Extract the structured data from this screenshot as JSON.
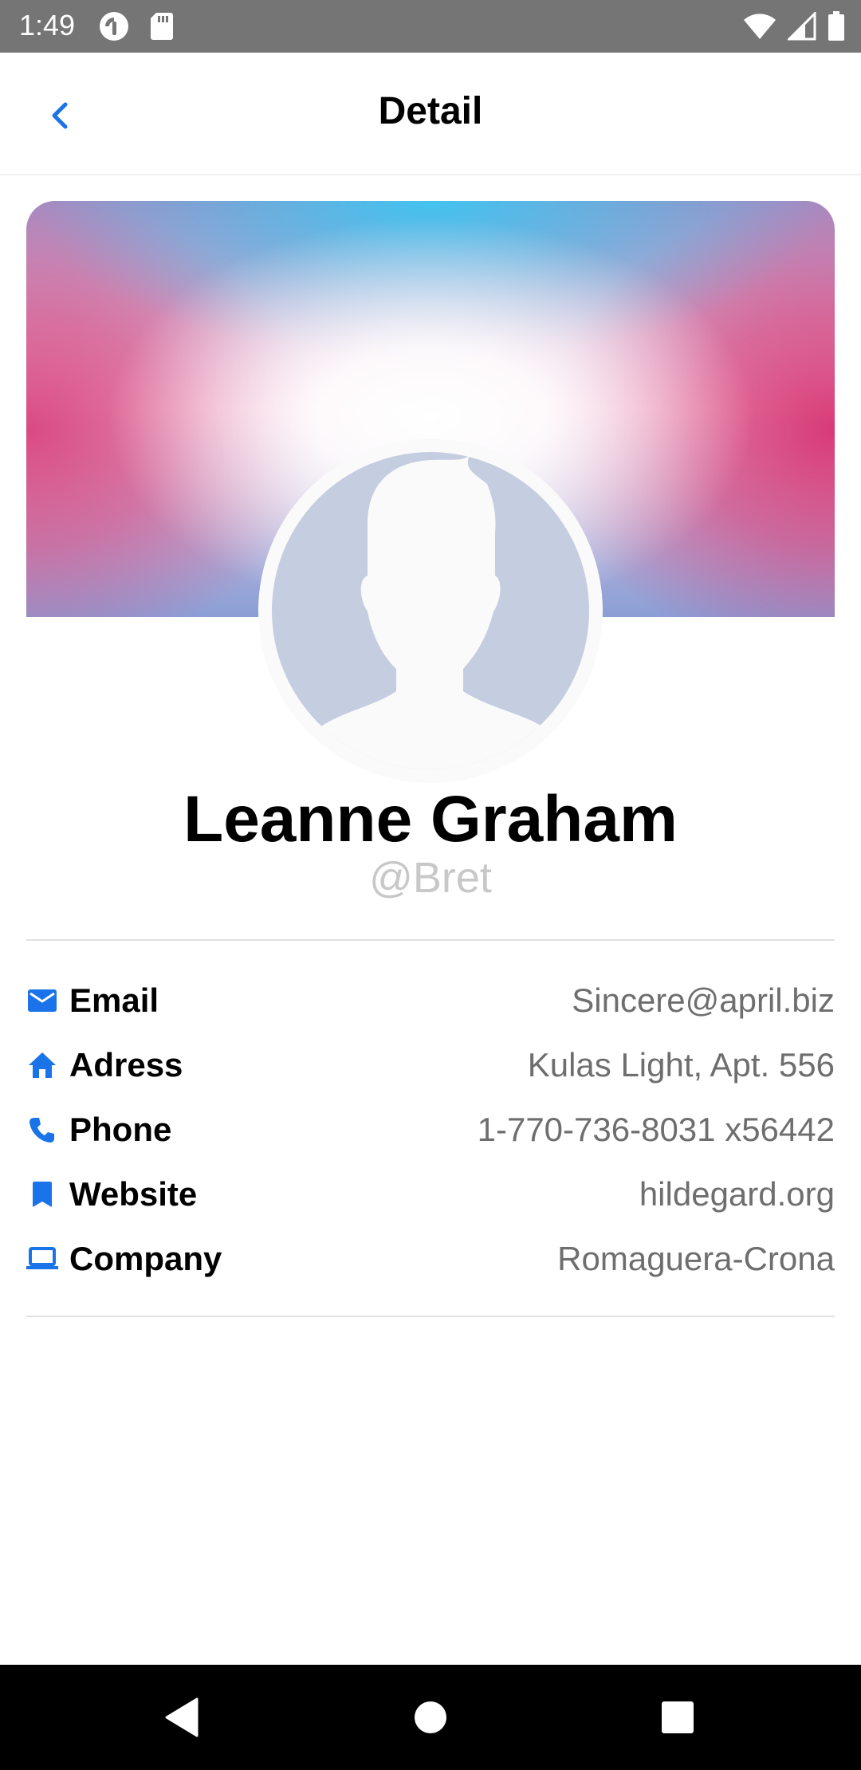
{
  "status_bar": {
    "time": "1:49",
    "left_icons": [
      "pocket-casts-icon",
      "sd-card-icon"
    ],
    "right_icons": [
      "wifi-icon",
      "signal-icon",
      "battery-icon"
    ]
  },
  "header": {
    "title": "Detail",
    "back_icon": "chevron-left-icon"
  },
  "profile": {
    "name": "Leanne Graham",
    "handle": "@Bret"
  },
  "details": [
    {
      "icon": "mail-icon",
      "label": "Email",
      "value": "Sincere@april.biz"
    },
    {
      "icon": "home-icon",
      "label": "Adress",
      "value": "Kulas Light, Apt. 556"
    },
    {
      "icon": "phone-icon",
      "label": "Phone",
      "value": "1-770-736-8031 x56442"
    },
    {
      "icon": "bookmark-icon",
      "label": "Website",
      "value": "hildegard.org"
    },
    {
      "icon": "laptop-icon",
      "label": "Company",
      "value": "Romaguera-Crona"
    }
  ],
  "nav_bar": {
    "buttons": [
      "back-triangle-icon",
      "home-circle-icon",
      "recents-square-icon"
    ]
  },
  "colors": {
    "accent": "#1a73e8",
    "status_bar": "#757575",
    "handle_text": "#c8c8c8",
    "value_text": "#6e6e6e"
  }
}
